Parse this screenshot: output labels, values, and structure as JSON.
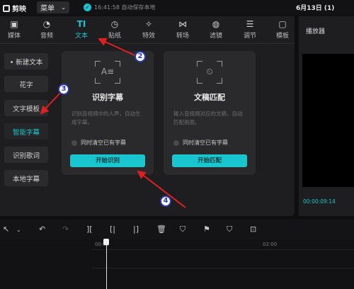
{
  "app": {
    "name": "剪映",
    "menu_label": "菜单",
    "menu_chevron": "chevron-down-icon",
    "save_status": "16:41:58 自动保存本地",
    "project_title": "6月13日 (1)"
  },
  "tabs": [
    {
      "label": "媒体",
      "icon": "media-icon"
    },
    {
      "label": "音频",
      "icon": "audio-icon"
    },
    {
      "label": "文本",
      "icon": "text-icon",
      "active": true
    },
    {
      "label": "贴纸",
      "icon": "sticker-icon"
    },
    {
      "label": "特效",
      "icon": "effects-icon"
    },
    {
      "label": "转场",
      "icon": "transition-icon"
    },
    {
      "label": "滤镜",
      "icon": "filter-icon"
    },
    {
      "label": "调节",
      "icon": "adjust-icon"
    },
    {
      "label": "模板",
      "icon": "template-icon"
    }
  ],
  "subnav": [
    {
      "label": "• 新建文本"
    },
    {
      "label": "花字"
    },
    {
      "label": "文字模板"
    },
    {
      "label": "智能字幕",
      "active": true
    },
    {
      "label": "识别歌词"
    },
    {
      "label": "本地字幕"
    }
  ],
  "cards": [
    {
      "title": "识别字幕",
      "desc": "识别音视频中的人声，自动生成字幕。",
      "checkbox": "同时清空已有字幕",
      "button": "开始识别"
    },
    {
      "title": "文稿匹配",
      "desc": "输入音视频对应的文稿，自动匹配画面。",
      "checkbox": "同时清空已有字幕",
      "button": "开始匹配"
    }
  ],
  "player": {
    "title": "播放器",
    "time": "00:00:09:14"
  },
  "timeline": {
    "ticks": [
      "00:00",
      "02:00"
    ]
  },
  "annotations": [
    "2",
    "3",
    "4"
  ],
  "colors": {
    "accent": "#19c6cf",
    "arrow": "#e02020",
    "badge_border": "#2a3aa8"
  }
}
